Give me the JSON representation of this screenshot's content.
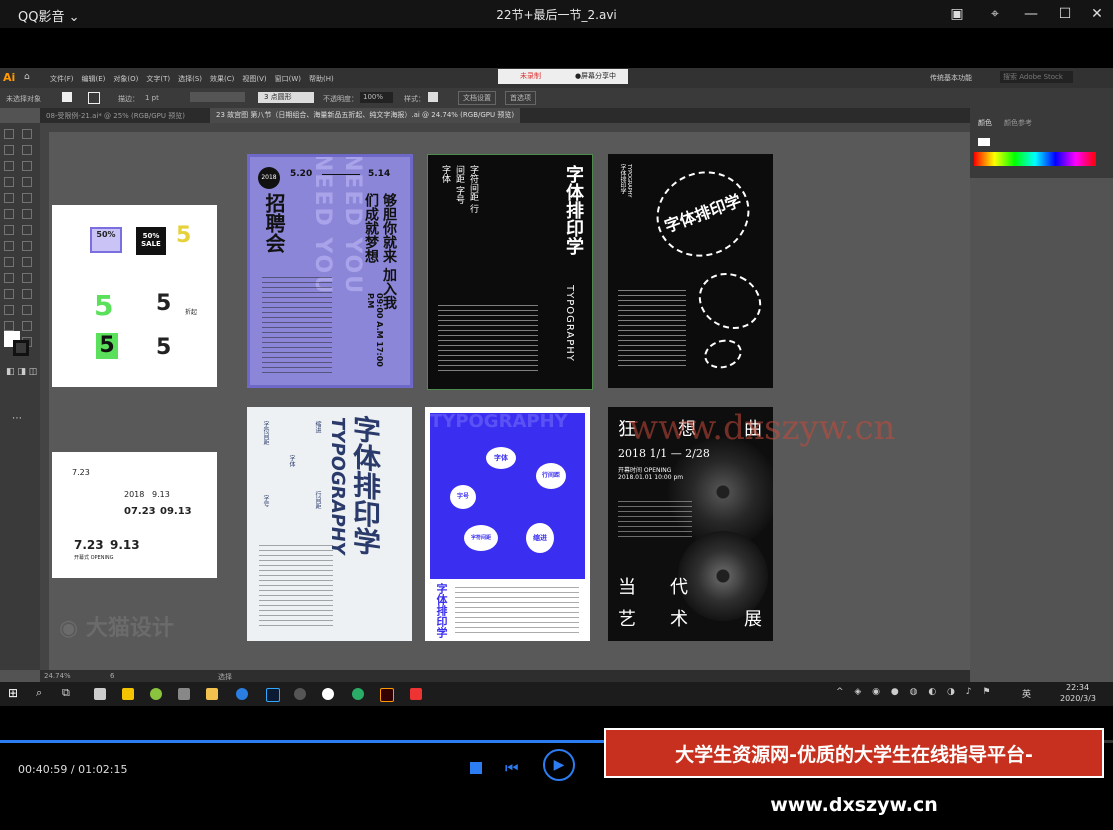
{
  "player": {
    "app_name": "QQ影音",
    "file_title": "22节+最后一节_2.avi",
    "current_time": "00:40:59",
    "total_time": "01:02:15",
    "progress": 0.658,
    "banner": "大学生资源网-优质的大学生在线指导平台-www.dxszyw.cn"
  },
  "illustrator": {
    "logo": "Ai",
    "menu": [
      "文件(F)",
      "编辑(E)",
      "对象(O)",
      "文字(T)",
      "选择(S)",
      "效果(C)",
      "视图(V)",
      "窗口(W)",
      "帮助(H)"
    ],
    "center_tabs": [
      "未录制",
      "●屏幕分享中"
    ],
    "workspace": "传统基本功能",
    "search_placeholder": "搜索 Adobe Stock",
    "control": {
      "selection": "未选择对象",
      "stroke_label": "描边：",
      "stroke_value": "1 pt",
      "brush": "3 点圆形",
      "opacity_label": "不透明度：",
      "opacity_value": "100%",
      "style_label": "样式：",
      "doc_setup": "文档设置",
      "prefs": "首选项"
    },
    "doc_tabs": [
      "08-受限例-21.ai* @ 25% (RGB/GPU 预览)",
      "23 故宫图 第八节（日期组合、海量新品五折起、纯文字海报）.ai @ 24.74% (RGB/GPU 预览)"
    ],
    "panel_tabs": [
      "颜色",
      "颜色参考"
    ],
    "zoom": "24.74%",
    "page": "6",
    "status": "选择"
  },
  "artwork": {
    "ab1": {
      "date": "2018",
      "range_a": "5.20",
      "range_b": "5.14",
      "title": "招聘会",
      "slogan": "够胆你就来 加入我们成就梦想",
      "time": "09:00 A.M  17:00 P.M",
      "bg_word": "NEED YOU"
    },
    "ab2": {
      "vertical_cn": "字体排印学",
      "vertical_en": "TYPOGRAPHY",
      "small": "字符间距 行间距 字号 字体"
    },
    "ab3": {
      "text": "字体排印学",
      "en": "TYPOGRAPHY"
    },
    "ab4": {
      "title": "字体排印学",
      "en": "TYPOGRAPHY",
      "items": [
        "字符间距",
        "缩进",
        "字体",
        "行间距",
        "字号"
      ]
    },
    "ab5": {
      "bg_word": "TYPOGRAPHY",
      "bubbles": [
        "字体",
        "行间距",
        "字号",
        "字符间距",
        "缩进"
      ],
      "vertical": "字体排印学"
    },
    "ab6": {
      "top_left": "狂",
      "top_mid": "想",
      "top_right": "曲",
      "dates": "2018 1/1 — 2/28",
      "opening": "开幕时间 OPENING",
      "opening_time": "2018.01.01  10:00 pm",
      "bottom": [
        "当",
        "代",
        "艺",
        "术",
        "展"
      ]
    },
    "left1": {
      "sale": "50%",
      "sale2": "50% SALE",
      "five": "5",
      "tag": "折起"
    },
    "left2": {
      "date1": "7.23",
      "date2": "9.13",
      "date3": "07.23",
      "date4": "09.13",
      "year": "2018",
      "opening": "开幕式 OPENING"
    },
    "watermark_logo": "大猫设计",
    "watermark_site": "www.dxszyw.cn"
  },
  "taskbar": {
    "time": "22:34",
    "date": "2020/3/3",
    "lang": "英"
  },
  "colors": {
    "accent_blue": "#2c7df2",
    "banner_red": "#c7301e",
    "poster_purple": "#8b86d8",
    "poster_blue": "#3a2ff0"
  }
}
